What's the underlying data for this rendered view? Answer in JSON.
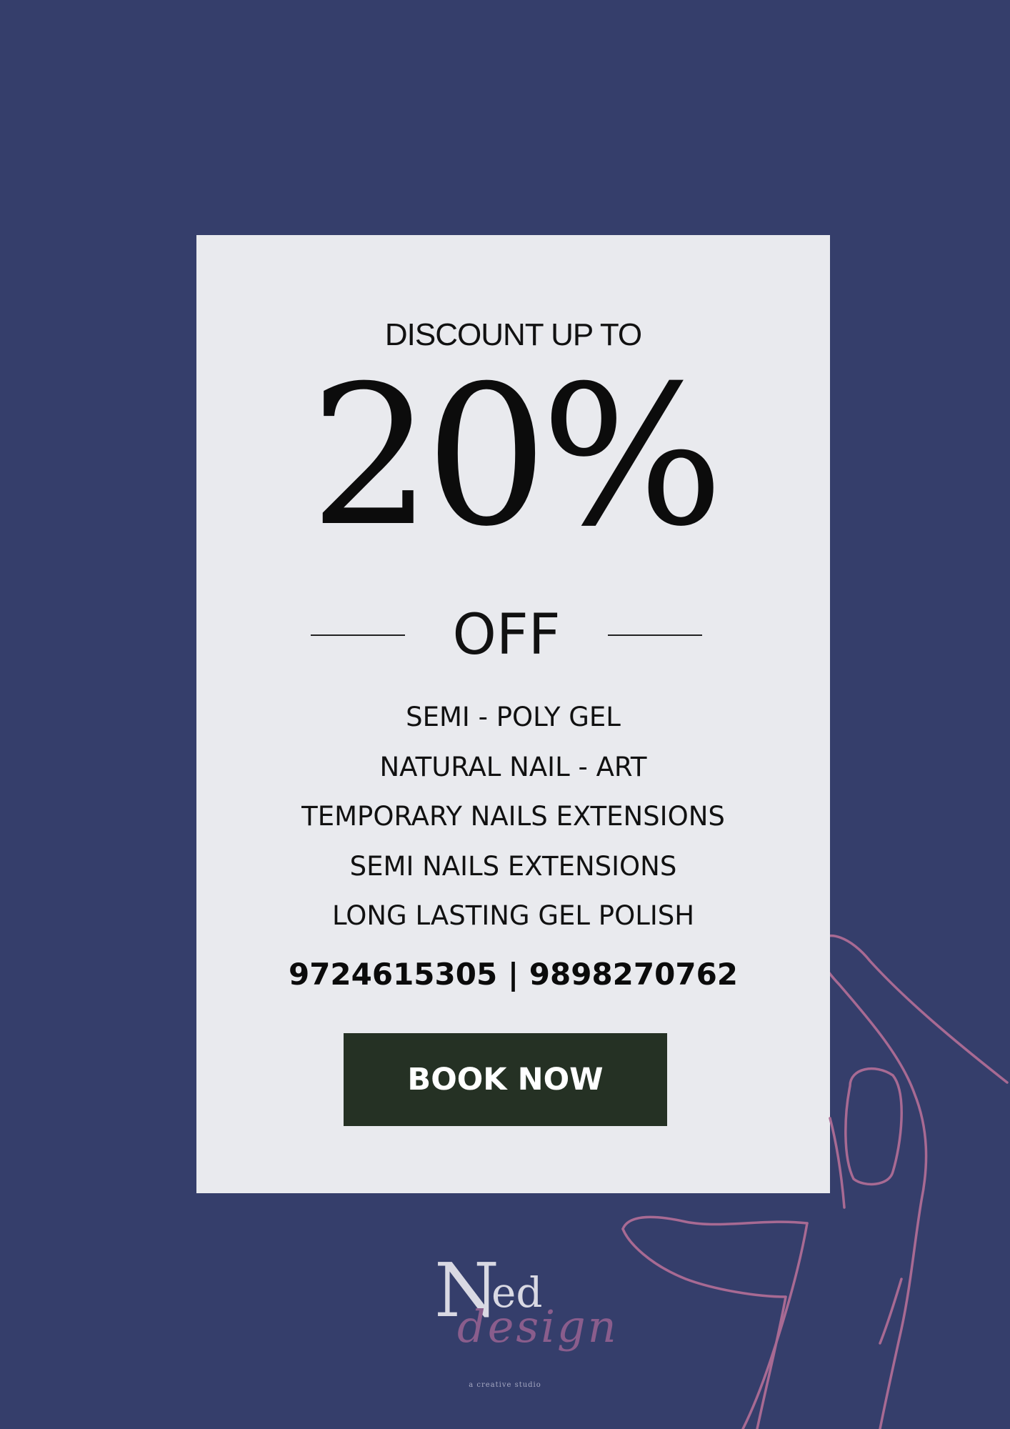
{
  "colors": {
    "background": "#353e6b",
    "card": "#e9eaee",
    "button": "#253124",
    "hand_outline": "#a86a93"
  },
  "promo": {
    "headline": "DISCOUNT UP TO",
    "amount": "20%",
    "off": "OFF"
  },
  "services": [
    "SEMI - POLY GEL",
    "NATURAL NAIL - ART",
    "TEMPORARY NAILS EXTENSIONS",
    "SEMI NAILS EXTENSIONS",
    "LONG LASTING GEL POLISH"
  ],
  "contact": {
    "phones": "9724615305 | 9898270762"
  },
  "cta": {
    "label": "BOOK NOW"
  },
  "brand": {
    "logo_mark": "N",
    "logo_ed": "ed",
    "logo_script": "design",
    "tagline": "a creative studio"
  },
  "illustration": "hand-outline-icon"
}
